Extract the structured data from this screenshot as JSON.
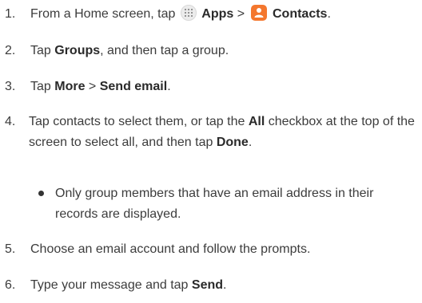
{
  "steps": [
    {
      "number": "1.",
      "prefix": "From a Home screen, tap ",
      "apps_label": "Apps",
      "separator": " > ",
      "contacts_label": "Contacts",
      "suffix": "."
    },
    {
      "number": "2.",
      "prefix": "Tap ",
      "bold1": "Groups",
      "suffix": ", and then tap a group."
    },
    {
      "number": "3.",
      "prefix": "Tap ",
      "bold1": "More",
      "separator": " > ",
      "bold2": "Send email",
      "suffix": "."
    },
    {
      "number": "4.",
      "prefix": "Tap contacts to select them, or tap the ",
      "bold1": "All",
      "middle": " checkbox at the top of the screen to select all, and then tap ",
      "bold2": "Done",
      "suffix": "."
    },
    {
      "number": "5.",
      "text": "Choose an email account and follow the prompts."
    },
    {
      "number": "6.",
      "prefix": "Type your message and tap ",
      "bold1": "Send",
      "suffix": "."
    }
  ],
  "note": {
    "text": "Only group members that have an email address in their records are displayed."
  },
  "icons": {
    "apps": "apps-grid-icon",
    "contacts": "contacts-person-icon",
    "contacts_color": "#f4772e"
  }
}
